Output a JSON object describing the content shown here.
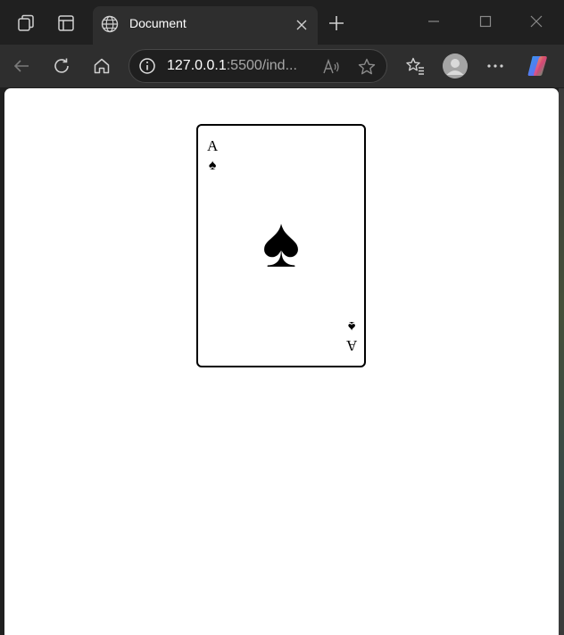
{
  "browser": {
    "tab": {
      "title": "Document"
    },
    "address": {
      "host": "127.0.0.1",
      "rest": ":5500/ind..."
    }
  },
  "icons": {
    "workspaces": "workspaces-icon",
    "tab_actions": "tab-actions-icon",
    "favicon": "globe-icon",
    "close_tab": "close-icon",
    "new_tab": "plus-icon",
    "minimize": "minimize-icon",
    "maximize": "maximize-icon",
    "close_window": "close-icon",
    "back": "back-arrow-icon",
    "refresh": "refresh-icon",
    "home": "home-icon",
    "info": "info-icon",
    "read_aloud": "read-aloud-icon",
    "favorite": "star-icon",
    "favorites": "favorites-icon",
    "profile": "profile-avatar-icon",
    "more": "more-icon",
    "copilot": "copilot-icon"
  },
  "card": {
    "rank": "A",
    "suit": "♠"
  }
}
